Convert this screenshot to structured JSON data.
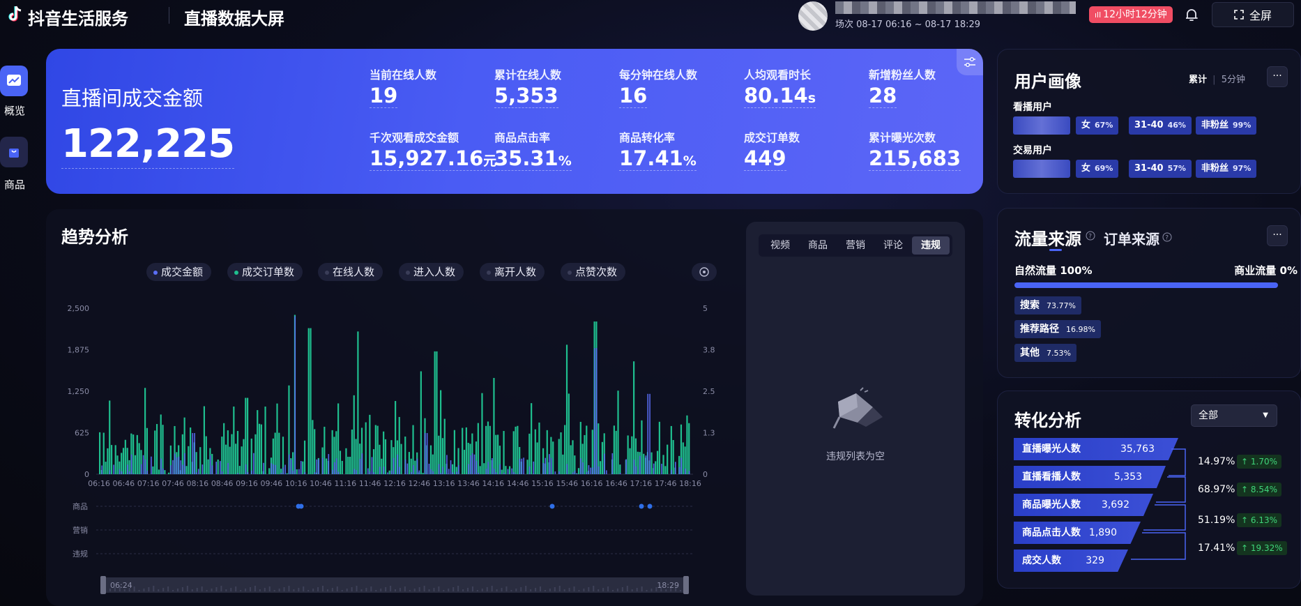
{
  "header": {
    "brand": "抖音生活服务",
    "screen_title": "直播数据大屏",
    "session": "场次 08-17 06:16 ~ 08-17 18:29",
    "live_badge": "12小时12分钟",
    "fullscreen_label": "全屏"
  },
  "sidebar": {
    "items": [
      {
        "label": "概览",
        "icon": "chart-icon",
        "active": true
      },
      {
        "label": "商品",
        "icon": "bag-icon",
        "active": false
      }
    ]
  },
  "hero": {
    "title": "直播间成交金额",
    "value": "122,225",
    "metrics": [
      {
        "label": "当前在线人数",
        "value": "19",
        "unit": ""
      },
      {
        "label": "累计在线人数",
        "value": "5,353",
        "unit": ""
      },
      {
        "label": "每分钟在线人数",
        "value": "16",
        "unit": ""
      },
      {
        "label": "人均观看时长",
        "value": "80.14",
        "unit": "s"
      },
      {
        "label": "新增粉丝人数",
        "value": "28",
        "unit": ""
      },
      {
        "label": "千次观看成交金额",
        "value": "15,927.16",
        "unit": "元"
      },
      {
        "label": "商品点击率",
        "value": "35.31",
        "unit": "%"
      },
      {
        "label": "商品转化率",
        "value": "17.41",
        "unit": "%"
      },
      {
        "label": "成交订单数",
        "value": "449",
        "unit": ""
      },
      {
        "label": "累计曝光次数",
        "value": "215,683",
        "unit": ""
      }
    ]
  },
  "trend": {
    "title": "趋势分析",
    "legend": [
      {
        "label": "成交金额",
        "color": "#5a6ef5"
      },
      {
        "label": "成交订单数",
        "color": "#1fbf8f"
      },
      {
        "label": "在线人数",
        "color": "#3a3d58"
      },
      {
        "label": "进入人数",
        "color": "#3a3d58"
      },
      {
        "label": "离开人数",
        "color": "#3a3d58"
      },
      {
        "label": "点赞次数",
        "color": "#3a3d58"
      }
    ],
    "event_rows": [
      "商品",
      "营销",
      "违规"
    ],
    "range_start": "06:24",
    "range_end": "18:29"
  },
  "chart_data": {
    "type": "bar",
    "x": [
      "06:16",
      "06:46",
      "07:16",
      "07:46",
      "08:16",
      "08:46",
      "09:16",
      "09:46",
      "10:16",
      "10:46",
      "11:16",
      "11:46",
      "12:16",
      "12:46",
      "13:16",
      "13:46",
      "14:16",
      "14:46",
      "15:16",
      "15:46",
      "16:16",
      "16:46",
      "17:16",
      "17:46",
      "18:16"
    ],
    "left_axis_ticks": [
      "0",
      "625",
      "1,250",
      "1,875",
      "2,500"
    ],
    "right_axis_ticks": [
      "0",
      "1.3",
      "2.5",
      "3.8",
      "5"
    ],
    "ylim_left": [
      0,
      2500
    ],
    "ylim_right": [
      0,
      5
    ],
    "series": [
      {
        "name": "成交金额",
        "color": "#5a6ef5",
        "axis": "left",
        "peaks": [
          [
            10.3,
            2380
          ],
          [
            18.7,
            1680
          ],
          [
            8.2,
            620
          ],
          [
            16.5,
            1900
          ],
          [
            13.0,
            620
          ],
          [
            17.6,
            1210
          ]
        ]
      },
      {
        "name": "成交订单数",
        "color": "#1fbf8f",
        "axis": "right",
        "peaks": [
          [
            10.3,
            4.8
          ],
          [
            10.6,
            4.4
          ],
          [
            11.6,
            4.3
          ],
          [
            13.2,
            3.7
          ],
          [
            15.9,
            3.9
          ],
          [
            16.5,
            4.6
          ],
          [
            18.7,
            4.8
          ],
          [
            7.2,
            2.6
          ],
          [
            9.3,
            2.3
          ],
          [
            12.9,
            3.1
          ],
          [
            14.4,
            2.9
          ],
          [
            17.3,
            3.4
          ]
        ]
      }
    ],
    "grid": false
  },
  "violation_panel": {
    "tabs": [
      "视频",
      "商品",
      "营销",
      "评论",
      "违规"
    ],
    "active_tab": "违规",
    "empty_text": "违规列表为空"
  },
  "persona": {
    "title": "用户画像",
    "toggle_cumulative": "累计",
    "toggle_5min": "5分钟",
    "more": "···",
    "rows": [
      {
        "label": "看播用户",
        "tags": [
          {
            "name": "女",
            "pct": "67%"
          },
          {
            "name": "31-40",
            "pct": "46%"
          },
          {
            "name": "非粉丝",
            "pct": "99%"
          }
        ]
      },
      {
        "label": "交易用户",
        "tags": [
          {
            "name": "女",
            "pct": "69%"
          },
          {
            "name": "31-40",
            "pct": "57%"
          },
          {
            "name": "非粉丝",
            "pct": "97%"
          }
        ]
      }
    ]
  },
  "traffic": {
    "tab_active": "流量来源",
    "tab_other": "订单来源",
    "natural": "自然流量 100%",
    "commercial": "商业流量 0%",
    "more": "···",
    "sources": [
      {
        "name": "搜索",
        "pct": "73.77%"
      },
      {
        "name": "推荐路径",
        "pct": "16.98%"
      },
      {
        "name": "其他",
        "pct": "7.53%"
      }
    ]
  },
  "conversion": {
    "title": "转化分析",
    "filter": "全部",
    "steps": [
      {
        "name": "直播曝光人数",
        "value": "35,763"
      },
      {
        "name": "直播看播人数",
        "value": "5,353"
      },
      {
        "name": "商品曝光人数",
        "value": "3,692"
      },
      {
        "name": "商品点击人数",
        "value": "1,890"
      },
      {
        "name": "成交人数",
        "value": "329"
      }
    ],
    "rates": [
      {
        "rate": "14.97%",
        "delta": "↑ 1.70%"
      },
      {
        "rate": "68.97%",
        "delta": "↑ 8.54%"
      },
      {
        "rate": "51.19%",
        "delta": "↑ 6.13%"
      },
      {
        "rate": "17.41%",
        "delta": "↑ 19.32%"
      }
    ]
  }
}
